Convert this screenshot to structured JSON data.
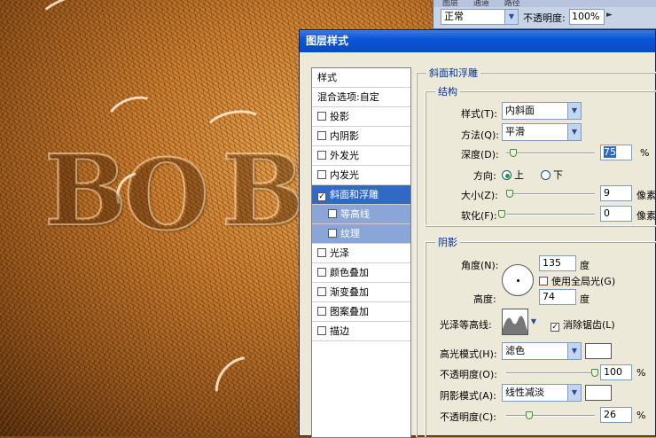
{
  "canvas": {
    "letters": [
      "B",
      "O",
      "B"
    ]
  },
  "top_panel": {
    "tabs": [
      "图层",
      "通道",
      "路径"
    ],
    "blend_mode": "正常",
    "opacity_label": "不透明度:",
    "opacity_value": "100%"
  },
  "dialog": {
    "title": "图层样式",
    "style_list": {
      "header": "样式",
      "blend_options": "混合选项:自定",
      "items": [
        {
          "label": "投影",
          "checked": false
        },
        {
          "label": "内阴影",
          "checked": false
        },
        {
          "label": "外发光",
          "checked": false
        },
        {
          "label": "内发光",
          "checked": false
        },
        {
          "label": "斜面和浮雕",
          "checked": true
        },
        {
          "label": "等高线",
          "checked": false
        },
        {
          "label": "纹理",
          "checked": false
        },
        {
          "label": "光泽",
          "checked": false
        },
        {
          "label": "颜色叠加",
          "checked": false
        },
        {
          "label": "渐变叠加",
          "checked": false
        },
        {
          "label": "图案叠加",
          "checked": false
        },
        {
          "label": "描边",
          "checked": false
        }
      ],
      "check_mark": "✓"
    },
    "bevel": {
      "section_title": "斜面和浮雕",
      "structure": {
        "title": "结构",
        "style_label": "样式(T):",
        "style_value": "内斜面",
        "technique_label": "方法(Q):",
        "technique_value": "平滑",
        "depth_label": "深度(D):",
        "depth_value": "75",
        "depth_unit": "%",
        "depth_fraction": 0.075,
        "direction_label": "方向:",
        "direction_up": "上",
        "direction_down": "下",
        "size_label": "大小(Z):",
        "size_value": "9",
        "size_unit": "像素",
        "size_fraction": 0.036,
        "soften_label": "软化(F):",
        "soften_value": "0",
        "soften_unit": "像素",
        "soften_fraction": 0.0
      },
      "shading": {
        "title": "阴影",
        "angle_label": "角度(N):",
        "angle_value": "135",
        "angle_unit": "度",
        "global_light_label": "使用全局光(G)",
        "altitude_label": "高度:",
        "altitude_value": "74",
        "altitude_unit": "度",
        "gloss_contour_label": "光泽等高线:",
        "anti_alias_label": "消除锯齿(L)",
        "highlight_mode_label": "高光模式(H):",
        "highlight_mode_value": "滤色",
        "highlight_color": "#ffffff",
        "highlight_opacity_label": "不透明度(O):",
        "highlight_opacity_value": "100",
        "highlight_opacity_unit": "%",
        "highlight_opacity_fraction": 1.0,
        "shadow_mode_label": "阴影模式(A):",
        "shadow_mode_value": "线性减淡",
        "shadow_color": "#ffffff",
        "shadow_opacity_label": "不透明度(C):",
        "shadow_opacity_value": "26",
        "shadow_opacity_unit": "%",
        "shadow_opacity_fraction": 0.26
      }
    }
  },
  "icons": {
    "dropdown": "▼",
    "flyout": "►"
  }
}
